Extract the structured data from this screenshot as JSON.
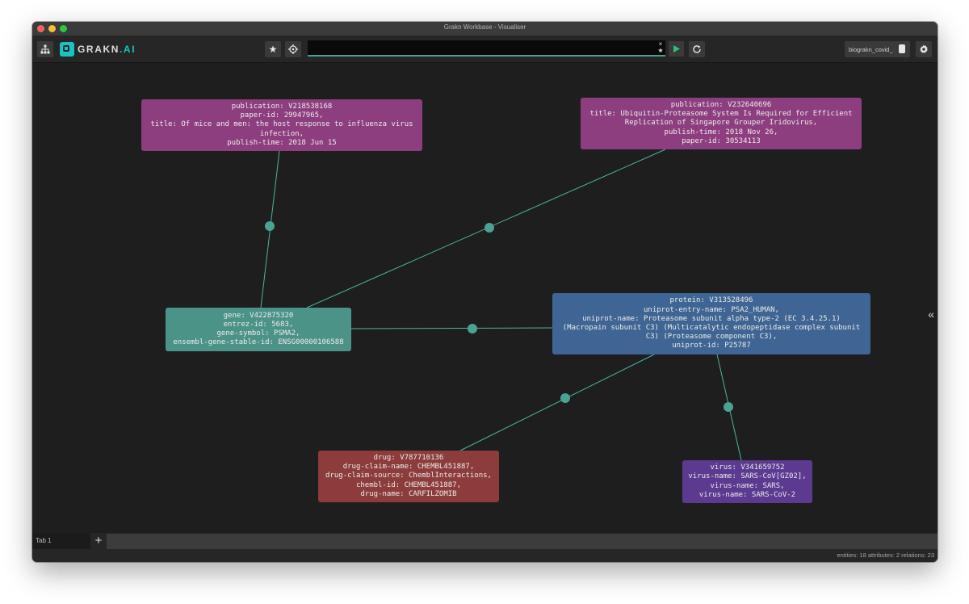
{
  "window": {
    "title": "Grakn Workbase - Visualiser"
  },
  "toolbar": {
    "logo_text": "GRAKN",
    "logo_ai": ".AI",
    "query_value": "",
    "clear_symbol": "×",
    "star_symbol": "★",
    "database": "biograkn_covid_"
  },
  "graph": {
    "nodes": [
      {
        "id": "pub1",
        "type": "publication",
        "lines": [
          "publication: V218538168",
          "paper-id: 29947965,",
          "title: Of mice and men: the host response to influenza virus",
          "infection,",
          "publish-time: 2018 Jun 15"
        ]
      },
      {
        "id": "pub2",
        "type": "publication",
        "lines": [
          "publication: V232640696",
          "title: Ubiquitin-Proteasome System Is Required for Efficient",
          "Replication of Singapore Grouper Iridovirus,",
          "publish-time: 2018 Nov 26,",
          "paper-id: 30534113"
        ]
      },
      {
        "id": "gene",
        "type": "gene",
        "lines": [
          "gene: V422875320",
          "entrez-id: 5683,",
          "gene-symbol: PSMA2,",
          "ensembl-gene-stable-id: ENSG00000106588"
        ]
      },
      {
        "id": "protein",
        "type": "protein",
        "lines": [
          "protein: V313528496",
          "uniprot-entry-name: PSA2_HUMAN,",
          "uniprot-name: Proteasome subunit alpha type-2 (EC 3.4.25.1)",
          "(Macropain subunit C3) (Multicatalytic endopeptidase complex subunit",
          "C3) (Proteasome component C3),",
          "uniprot-id: P25787"
        ]
      },
      {
        "id": "drug",
        "type": "drug",
        "lines": [
          "drug: V787710136",
          "drug-claim-name: CHEMBL451887,",
          "drug-claim-source: ChemblInteractions,",
          "chembl-id: CHEMBL451887,",
          "drug-name: CARFILZOMIB"
        ]
      },
      {
        "id": "virus",
        "type": "virus",
        "lines": [
          "virus: V341659752",
          "virus-name: SARS-CoV[GZ02],",
          "virus-name: SARS,",
          "virus-name: SARS-CoV-2"
        ]
      }
    ],
    "edges": [
      {
        "from": "pub1",
        "to": "gene"
      },
      {
        "from": "pub2",
        "to": "gene"
      },
      {
        "from": "gene",
        "to": "protein"
      },
      {
        "from": "protein",
        "to": "drug"
      },
      {
        "from": "protein",
        "to": "virus"
      }
    ],
    "colors": {
      "publication": "#8d3e7e",
      "gene": "#4b9386",
      "protein": "#3e6593",
      "drug": "#8c3c3a",
      "virus": "#5b3a90",
      "edge": "#49b5a1"
    }
  },
  "tabs": [
    {
      "label": "Tab 1"
    }
  ],
  "tabbar": {
    "add_label": "+"
  },
  "sidepanel": {
    "collapse_label": "«"
  },
  "status": {
    "text": "entities: 18 attributes: 2 relations: 23"
  }
}
